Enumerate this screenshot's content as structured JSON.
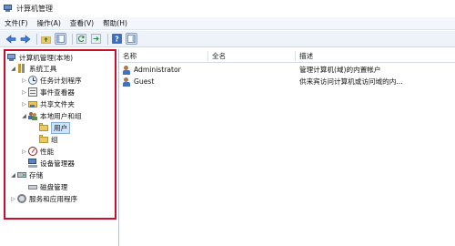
{
  "window": {
    "title": "计算机管理"
  },
  "menu": {
    "items": [
      "文件(F)",
      "操作(A)",
      "查看(V)",
      "帮助(H)"
    ]
  },
  "toolbar": {
    "buttons": [
      "back-icon",
      "forward-icon",
      "up-folder-icon",
      "show-hide-tree-icon",
      "refresh-icon",
      "export-icon",
      "help-icon",
      "properties-icon"
    ]
  },
  "tree": {
    "root": "计算机管理(本地)",
    "system_tools": "系统工具",
    "task_scheduler": "任务计划程序",
    "event_viewer": "事件查看器",
    "shared_folders": "共享文件夹",
    "local_users_groups": "本地用户和组",
    "users": "用户",
    "groups": "组",
    "performance": "性能",
    "device_manager": "设备管理器",
    "storage": "存储",
    "disk_management": "磁盘管理",
    "services_apps": "服务和应用程序"
  },
  "list": {
    "columns": {
      "name": "名称",
      "full_name": "全名",
      "description": "描述"
    },
    "rows": [
      {
        "name": "Administrator",
        "full_name": "",
        "description": "管理计算机(域)的内置帐户"
      },
      {
        "name": "Guest",
        "full_name": "",
        "description": "供来宾访问计算机或访问域的内..."
      }
    ]
  },
  "colors": {
    "highlight_border": "#c8102e",
    "selection": "#cfe3fb"
  }
}
